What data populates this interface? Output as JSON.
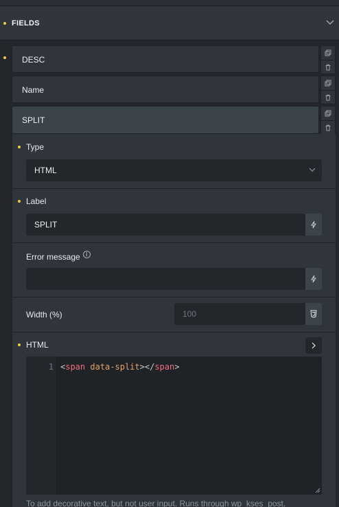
{
  "section": {
    "title": "FIELDS"
  },
  "fields": [
    {
      "label": "DESC"
    },
    {
      "label": "Name"
    },
    {
      "label": "SPLIT"
    }
  ],
  "controls": {
    "type": {
      "label": "Type",
      "value": "HTML"
    },
    "label": {
      "label": "Label",
      "value": "SPLIT"
    },
    "error_message": {
      "label": "Error message",
      "value": "",
      "info": "i"
    },
    "width": {
      "label": "Width (%)",
      "placeholder": "100"
    },
    "html": {
      "label": "HTML",
      "line_number": "1",
      "code": {
        "open_bracket": "<",
        "tag": "span",
        "attr": " data-split",
        "close_bracket": "></",
        "end_tag": "span",
        "end_bracket": ">"
      },
      "help_text": "To add decorative text, but not user input. Runs through wp_kses_post."
    }
  },
  "colors": {
    "accent_dot": "#f2c94c",
    "panel": "#2f353b",
    "input_bg": "#23272c"
  }
}
